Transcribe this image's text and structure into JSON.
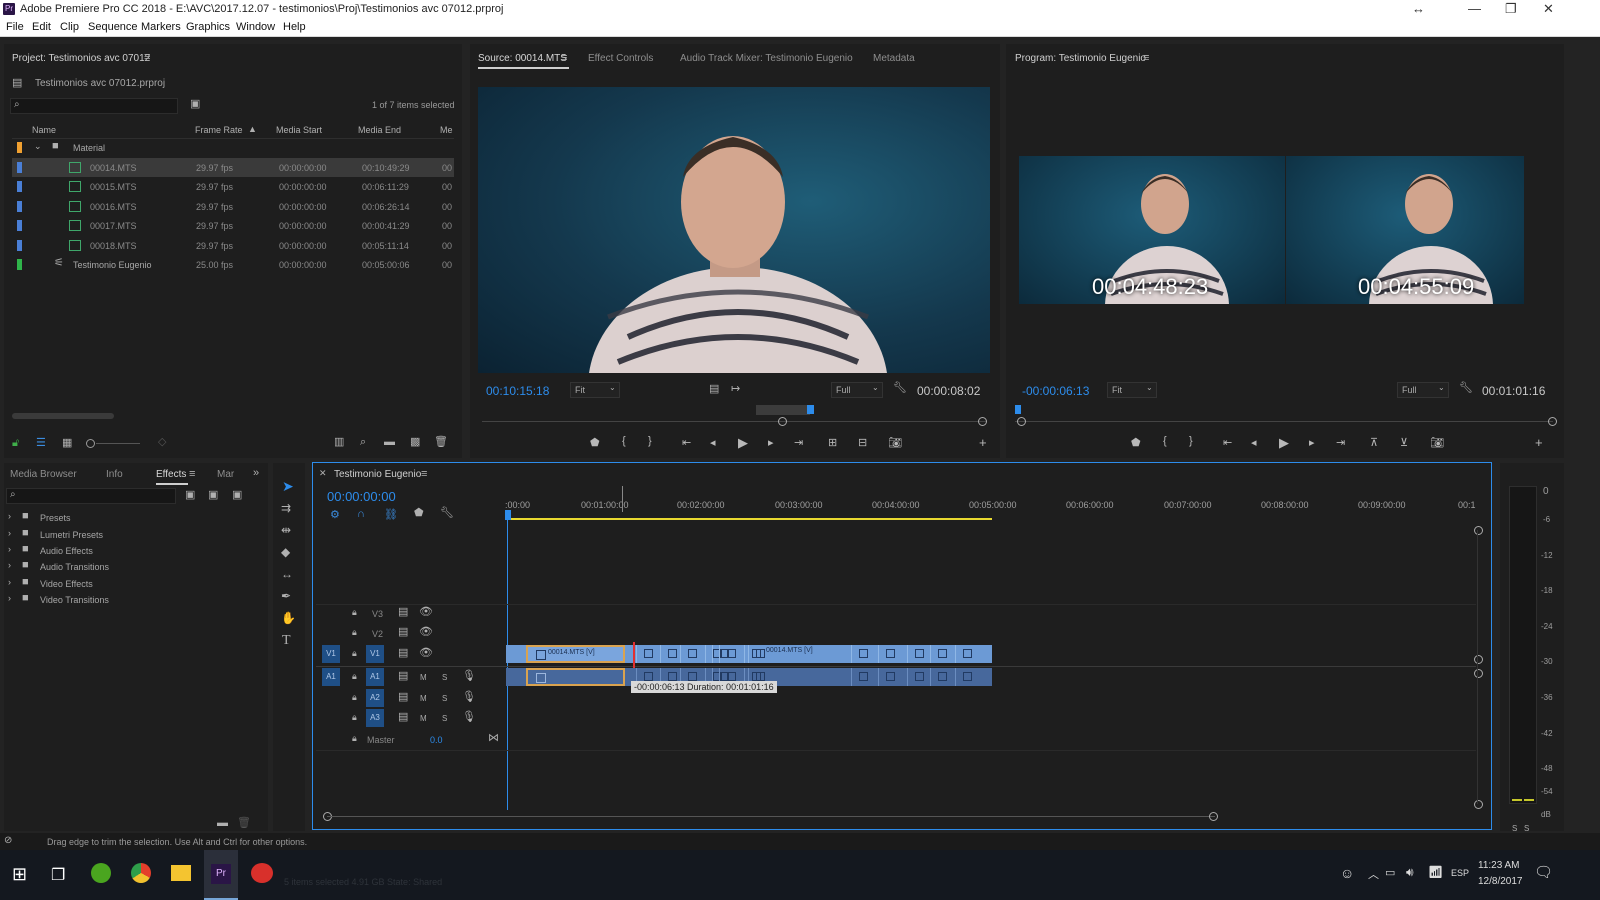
{
  "window": {
    "title": "Adobe Premiere Pro CC 2018 - E:\\AVC\\2017.12.07 - testimonios\\Proj\\Testimonios avc 07012.prproj",
    "app_badge": "Pr"
  },
  "menu": [
    "File",
    "Edit",
    "Clip",
    "Sequence",
    "Markers",
    "Graphics",
    "Window",
    "Help"
  ],
  "project": {
    "title": "Project: Testimonios avc 07012",
    "file": "Testimonios avc 07012.prproj",
    "selection_count": "1 of 7 items selected",
    "columns": [
      "Name",
      "Frame Rate",
      "Media Start",
      "Media End",
      "Me"
    ],
    "folder": "Material",
    "items": [
      {
        "name": "00014.MTS",
        "fps": "29.97 fps",
        "start": "00:00:00:00",
        "end": "00:10:49:29",
        "extra": "00",
        "color": "#4a7fd6"
      },
      {
        "name": "00015.MTS",
        "fps": "29.97 fps",
        "start": "00:00:00:00",
        "end": "00:06:11:29",
        "extra": "00",
        "color": "#4a7fd6"
      },
      {
        "name": "00016.MTS",
        "fps": "29.97 fps",
        "start": "00:00:00:00",
        "end": "00:06:26:14",
        "extra": "00",
        "color": "#4a7fd6"
      },
      {
        "name": "00017.MTS",
        "fps": "29.97 fps",
        "start": "00:00:00:00",
        "end": "00:00:41:29",
        "extra": "00",
        "color": "#4a7fd6"
      },
      {
        "name": "00018.MTS",
        "fps": "29.97 fps",
        "start": "00:00:00:00",
        "end": "00:05:11:14",
        "extra": "00",
        "color": "#4a7fd6"
      },
      {
        "name": "Testimonio Eugenio",
        "fps": "25.00 fps",
        "start": "00:00:00:00",
        "end": "00:05:00:06",
        "extra": "00",
        "color": "#2fb44a"
      }
    ]
  },
  "source": {
    "tabs": [
      "Source: 00014.MTS",
      "Effect Controls",
      "Audio Track Mixer: Testimonio Eugenio",
      "Metadata"
    ],
    "timecode": "00:10:15:18",
    "fit": "Fit",
    "quality": "Full",
    "duration": "00:00:08:02",
    "playhead_position": 0.65
  },
  "program": {
    "title": "Program: Testimonio Eugenio",
    "timecode": "-00:00:06:13",
    "fit": "Fit",
    "quality": "Full",
    "duration": "00:01:01:16",
    "left_frame_tc": "00:04:48:23",
    "right_frame_tc": "00:04:55:09"
  },
  "effects_panel": {
    "tabs": [
      "Media Browser",
      "Info",
      "Effects",
      "Mar"
    ],
    "items": [
      "Presets",
      "Lumetri Presets",
      "Audio Effects",
      "Audio Transitions",
      "Video Effects",
      "Video Transitions"
    ]
  },
  "timeline": {
    "title": "Testimonio Eugenio",
    "timecode": "00:00:00:00",
    "ruler": [
      ":00:00",
      "00:01:00:00",
      "00:02:00:00",
      "00:03:00:00",
      "00:04:00:00",
      "00:05:00:00",
      "00:06:00:00",
      "00:07:00:00",
      "00:08:00:00",
      "00:09:00:00",
      "00:1"
    ],
    "video_tracks": [
      "V3",
      "V2",
      "V1"
    ],
    "audio_tracks": [
      "A1",
      "A2",
      "A3"
    ],
    "src_v": "V1",
    "src_a": "A1",
    "master_label": "Master",
    "master_value": "0.0",
    "clip_label_1": "00014.MTS [V]",
    "clip_label_2": "00014.MTS [V]",
    "tooltip": "-00:00:06:13 Duration: 00:01:01:16",
    "mute": "M",
    "solo": "S"
  },
  "meter": {
    "scale": [
      "0",
      "-6",
      "-12",
      "-18",
      "-24",
      "-30",
      "-36",
      "-42",
      "-48",
      "-54",
      "dB"
    ],
    "solo_left": "S",
    "solo_right": "S"
  },
  "status": {
    "hint": "Drag edge to trim the selection. Use Alt and Ctrl for other options."
  },
  "taskbar": {
    "time": "11:23 AM",
    "date": "12/8/2017",
    "lang": "ESP",
    "ghost_text": "5 items selected  4.91 GB     State: Shared"
  }
}
